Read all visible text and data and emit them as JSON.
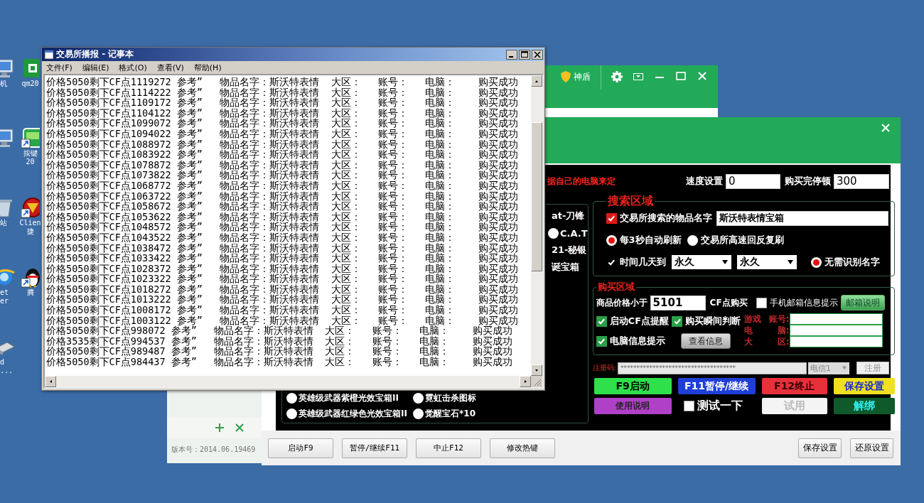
{
  "desktop_icons": [
    {
      "kind": "monitor",
      "shortcut": false,
      "label_lines": [
        "机"
      ]
    },
    {
      "kind": "app",
      "shortcut": false,
      "label_lines": [
        "qm20"
      ]
    },
    {
      "kind": "monitor",
      "shortcut": false
    },
    {
      "kind": "app-m",
      "shortcut": true,
      "label_lines": [
        "按键",
        "20"
      ]
    },
    {
      "kind": "recycle-bin",
      "shortcut": false,
      "label_lines": [
        "站"
      ]
    },
    {
      "kind": "game",
      "shortcut": true,
      "label_lines": [
        "Clien",
        "捷"
      ]
    },
    {
      "kind": "browser",
      "shortcut": false,
      "label_lines": [
        "et",
        "er"
      ]
    },
    {
      "kind": "penguin",
      "shortcut": true,
      "label_lines": [
        "腾"
      ]
    },
    {
      "kind": "disk",
      "shortcut": false,
      "label_lines": [
        "d",
        "..."
      ]
    }
  ],
  "shield_window": {
    "brand": "神盾",
    "version": "版本号：2014.06.19469"
  },
  "main_window": {
    "hint": "据自己的电脑来定",
    "speed": {
      "label": "速度设置",
      "value": "0"
    },
    "pause": {
      "label": "购买完停顿",
      "value": "300"
    },
    "left_items": [
      {
        "kind": "text",
        "label": "at-刀锋"
      },
      {
        "kind": "radio",
        "label": "C.A.T",
        "selected": false
      },
      {
        "kind": "text",
        "label": "21-秘银"
      },
      {
        "kind": "text",
        "label": "诞宝箱"
      }
    ],
    "left_bottom": [
      {
        "label": "英雄级武器紫橙光效宝箱II",
        "selected": false
      },
      {
        "label": "霓虹击杀图标",
        "selected": false
      },
      {
        "label": "英雄级武器红绿色光效宝箱II",
        "selected": false
      },
      {
        "label": "觉醒宝石*10",
        "selected": false
      }
    ],
    "search": {
      "title": "搜索区域",
      "name_check": {
        "label": "交易所搜索的物品名字",
        "checked": true
      },
      "name_value": "斯沃特表情宝箱",
      "refresh": [
        {
          "label": "每3秒自动刷新",
          "selected": true
        },
        {
          "label": "交易所高速回反复刷",
          "selected": false
        }
      ],
      "time_check": {
        "label": "时间几天到",
        "checked": true
      },
      "time_from": "永久",
      "time_to": "永久",
      "no_name": {
        "label": "无需识别名字",
        "selected": true
      }
    },
    "buy": {
      "title": "购买区域",
      "price_label": "商品价格小于",
      "price_value": "5101",
      "price_unit": "CF点购买",
      "mail_check": {
        "label": "手机邮箱信息提示",
        "checked": false
      },
      "mail_button": "邮箱说明",
      "checks": [
        {
          "label": "启动CF点提醒",
          "checked": true
        },
        {
          "label": "购买瞬间判断",
          "checked": true
        },
        {
          "label": "电脑信息提示",
          "checked": true
        }
      ],
      "info_button": "查看信息",
      "account_fields": [
        {
          "prefix": "游戏",
          "label": "账号:"
        },
        {
          "prefix": "电",
          "label": "脑:"
        },
        {
          "prefix": "大",
          "label": "区:"
        }
      ]
    },
    "register": {
      "label": "注册码:",
      "value": "************************************",
      "line": "电信1",
      "button": "注册"
    },
    "actions": [
      {
        "kind": "button",
        "label": "F9启动",
        "color": "#2ee04a",
        "disabled": false
      },
      {
        "kind": "button",
        "label": "F11暂停/继续",
        "color": "#1f3fd8",
        "disabled": false
      },
      {
        "kind": "button",
        "label": "F12终止",
        "color": "#e8303a",
        "disabled": false
      },
      {
        "kind": "button",
        "label": "保存设置",
        "color": "#f0e020",
        "disabled": false
      },
      {
        "kind": "button",
        "label": "使用说明",
        "color": "#b040c8",
        "disabled": false
      },
      {
        "kind": "checkbox",
        "label": "测试一下",
        "checked": false
      },
      {
        "kind": "button",
        "label": "试用",
        "color": "#f4f4f4",
        "disabled": true
      },
      {
        "kind": "button",
        "label": "解绑",
        "color": "#0e5a2a",
        "disabled": false
      }
    ],
    "bottom_left": [
      "启动F9",
      "暂停/继续F11",
      "中止F12",
      "修改热键"
    ],
    "bottom_right": [
      "保存设置",
      "还原设置"
    ]
  },
  "notepad": {
    "title": "交易所播报 - 记事本",
    "menu": [
      "文件(F)",
      "编辑(E)",
      "格式(O)",
      "查看(V)",
      "帮助(H)"
    ],
    "lines": [
      "价格5050剩下CF点1119272 参考”   物品名字：斯沃特表情  大区：   账号：   电脑：    购买成功",
      "价格5050剩下CF点1114222 参考”   物品名字：斯沃特表情  大区：   账号：   电脑：    购买成功",
      "价格5050剩下CF点1109172 参考”   物品名字：斯沃特表情  大区：   账号：   电脑：    购买成功",
      "价格5050剩下CF点1104122 参考”   物品名字：斯沃特表情  大区：   账号：   电脑：    购买成功",
      "价格5050剩下CF点1099072 参考”   物品名字：斯沃特表情  大区：   账号：   电脑：    购买成功",
      "价格5050剩下CF点1094022 参考”   物品名字：斯沃特表情  大区：   账号：   电脑：    购买成功",
      "价格5050剩下CF点1088972 参考”   物品名字：斯沃特表情  大区：   账号：   电脑：    购买成功",
      "价格5050剩下CF点1083922 参考”   物品名字：斯沃特表情  大区：   账号：   电脑：    购买成功",
      "价格5050剩下CF点1078872 参考”   物品名字：斯沃特表情  大区：   账号：   电脑：    购买成功",
      "价格5050剩下CF点1073822 参考”   物品名字：斯沃特表情  大区：   账号：   电脑：    购买成功",
      "价格5050剩下CF点1068772 参考”   物品名字：斯沃特表情  大区：   账号：   电脑：    购买成功",
      "价格5050剩下CF点1063722 参考”   物品名字：斯沃特表情  大区：   账号：   电脑：    购买成功",
      "价格5050剩下CF点1058672 参考”   物品名字：斯沃特表情  大区：   账号：   电脑：    购买成功",
      "价格5050剩下CF点1053622 参考”   物品名字：斯沃特表情  大区：   账号：   电脑：    购买成功",
      "价格5050剩下CF点1048572 参考”   物品名字：斯沃特表情  大区：   账号：   电脑：    购买成功",
      "价格5050剩下CF点1043522 参考”   物品名字：斯沃特表情  大区：   账号：   电脑：    购买成功",
      "价格5050剩下CF点1038472 参考”   物品名字：斯沃特表情  大区：   账号：   电脑：    购买成功",
      "价格5050剩下CF点1033422 参考”   物品名字：斯沃特表情  大区：   账号：   电脑：    购买成功",
      "价格5050剩下CF点1028372 参考”   物品名字：斯沃特表情  大区：   账号：   电脑：    购买成功",
      "价格5050剩下CF点1023322 参考”   物品名字：斯沃特表情  大区：   账号：   电脑：    购买成功",
      "价格5050剩下CF点1018272 参考”   物品名字：斯沃特表情  大区：   账号：   电脑：    购买成功",
      "价格5050剩下CF点1013222 参考”   物品名字：斯沃特表情  大区：   账号：   电脑：    购买成功",
      "价格5050剩下CF点1008172 参考”   物品名字：斯沃特表情  大区：   账号：   电脑：    购买成功",
      "价格5050剩下CF点1003122 参考”   物品名字：斯沃特表情  大区：   账号：   电脑：    购买成功",
      "价格5050剩下CF点998072 参考”   物品名字：斯沃特表情  大区：   账号：   电脑：    购买成功",
      "价格3535剩下CF点994537 参考”   物品名字：斯沃特表情  大区：   账号：   电脑：    购买成功",
      "价格5050剩下CF点989487 参考”   物品名字：斯沃特表情  大区：   账号：   电脑：    购买成功",
      "价格5050剩下CF点984437 参考”   物品名字：斯沃特表情  大区：   账号：   电脑：    购买成功"
    ]
  }
}
